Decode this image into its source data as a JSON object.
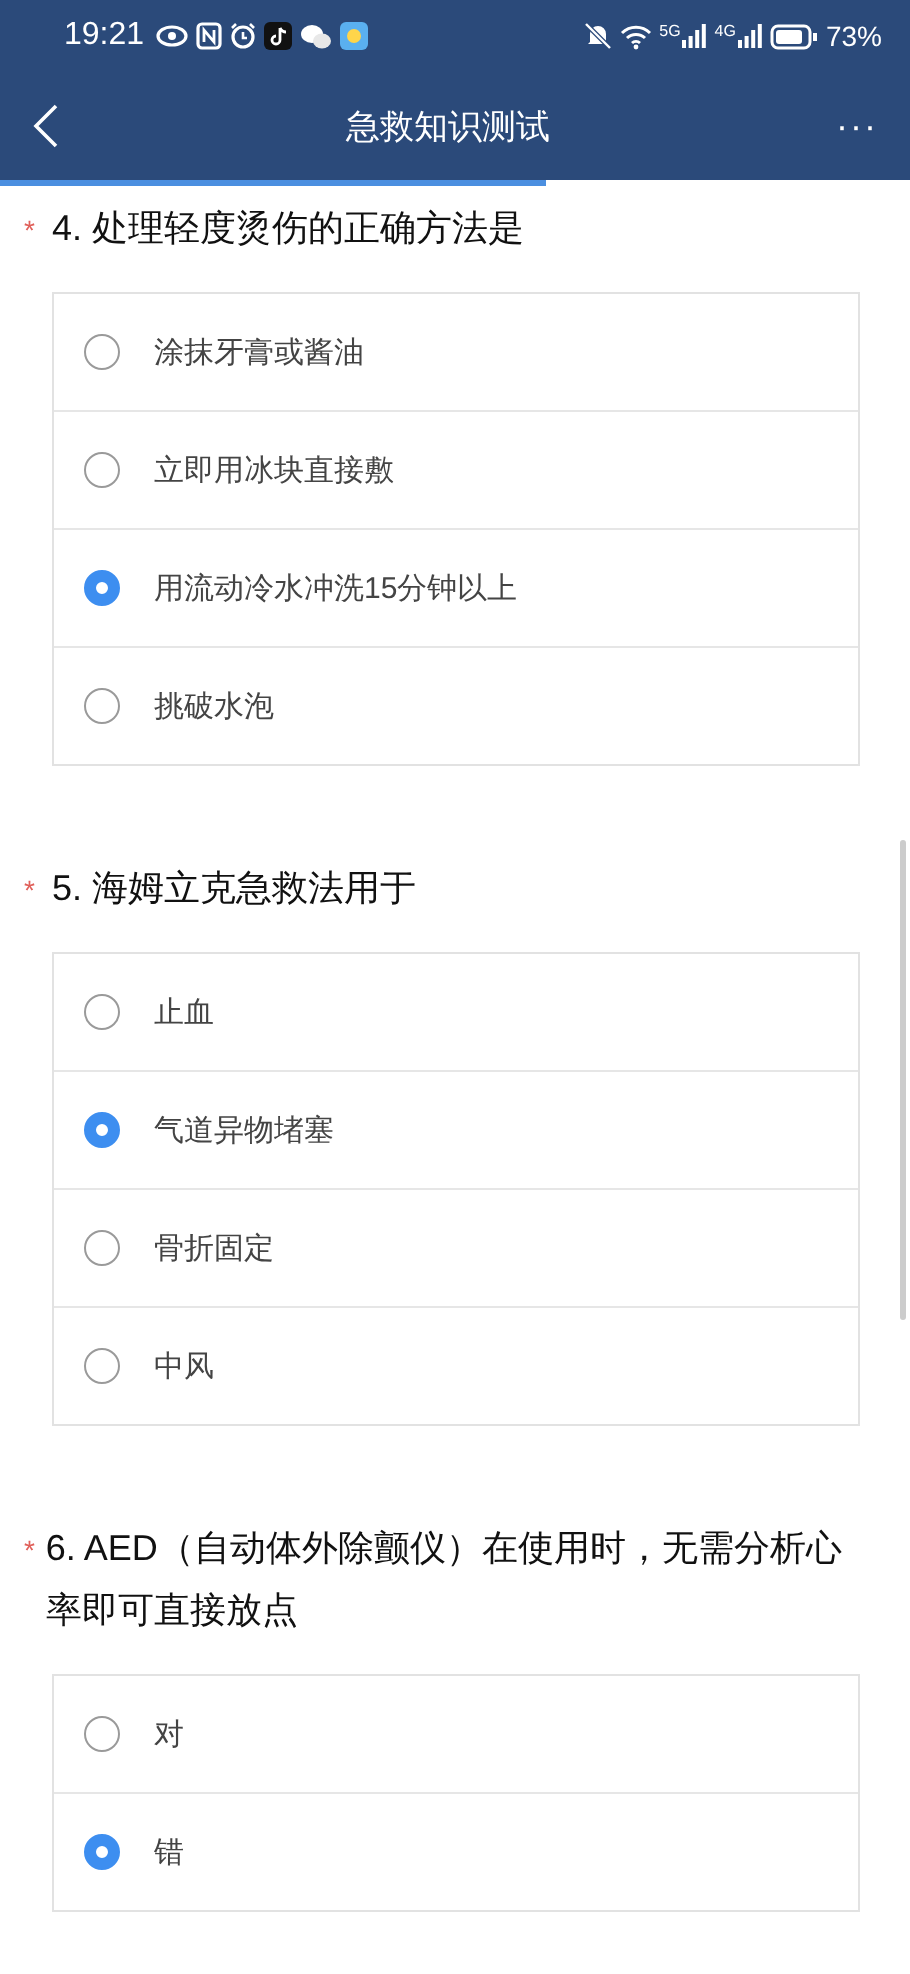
{
  "status_bar": {
    "time": "19:21",
    "network_1": "5G",
    "network_2": "4G",
    "battery": "73%"
  },
  "header": {
    "title": "急救知识测试",
    "more": "···"
  },
  "progress": {
    "level": 0.6
  },
  "questions": [
    {
      "mark": "*",
      "title": "4. 处理轻度烫伤的正确方法是",
      "options": [
        {
          "label": "涂抹牙膏或酱油",
          "selected": false
        },
        {
          "label": "立即用冰块直接敷",
          "selected": false
        },
        {
          "label": "用流动冷水冲洗15分钟以上",
          "selected": true
        },
        {
          "label": "挑破水泡",
          "selected": false
        }
      ]
    },
    {
      "mark": "*",
      "title": "5. 海姆立克急救法用于",
      "options": [
        {
          "label": "止血",
          "selected": false
        },
        {
          "label": "气道异物堵塞",
          "selected": true
        },
        {
          "label": "骨折固定",
          "selected": false
        },
        {
          "label": "中风",
          "selected": false
        }
      ]
    },
    {
      "mark": "*",
      "title": "6. AED（自动体外除颤仪）在使用时，无需分析心率即可直接放点",
      "options": [
        {
          "label": "对",
          "selected": false
        },
        {
          "label": "错",
          "selected": true
        }
      ]
    }
  ]
}
